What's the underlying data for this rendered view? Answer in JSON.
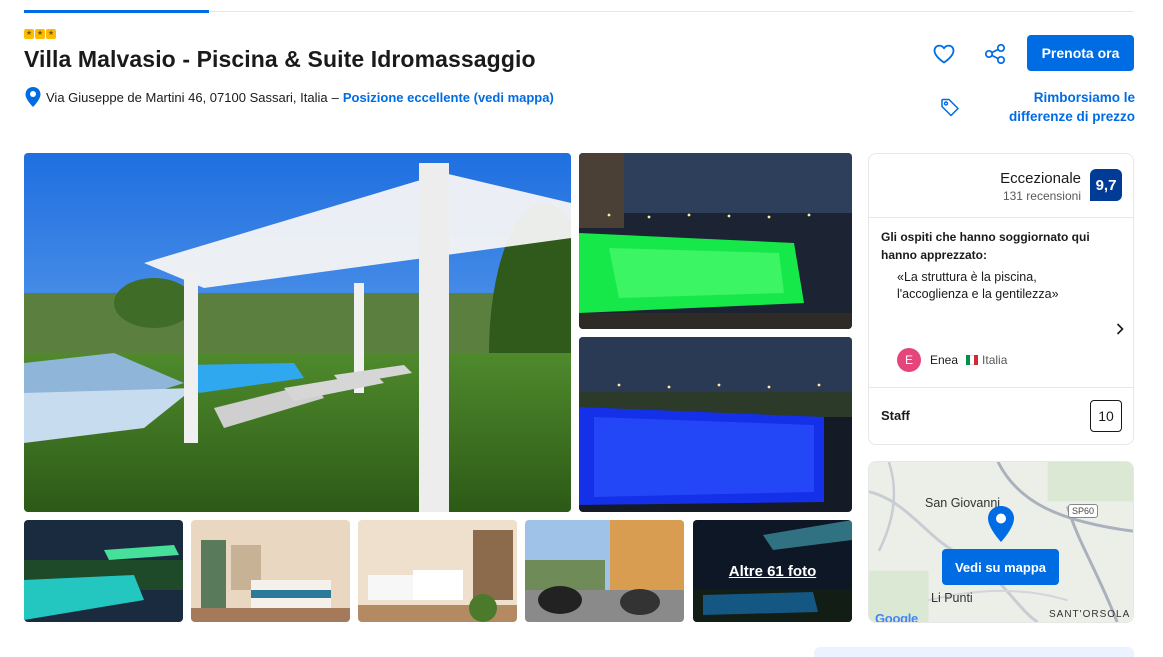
{
  "hotel": {
    "name": "Villa Malvasio - Piscina & Suite Idromassaggio",
    "stars": 3,
    "address": "Via Giuseppe de Martini 46, 07100 Sassari, Italia",
    "address_separator": "–",
    "location_link": "Posizione eccellente (vedi mappa)"
  },
  "header": {
    "book_button": "Prenota ora",
    "price_match": "Rimborsiamo le differenze di prezzo"
  },
  "gallery": {
    "more_photos": "Altre 61 foto"
  },
  "review": {
    "rating_word": "Eccezionale",
    "review_count": "131 recensioni",
    "score": "9,7",
    "guests_liked": "Gli ospiti che hanno soggiornato qui hanno apprezzato:",
    "quote": "«La struttura è la piscina, l'accoglienza e la gentilezza»",
    "reviewer_initial": "E",
    "reviewer_name": "Enea",
    "reviewer_country": "Italia",
    "staff_label": "Staff",
    "staff_score": "10"
  },
  "map": {
    "place_top": "San Giovanni",
    "road_badge": "SP60",
    "place_bottom": "Li Punti",
    "place_corner": "SANT'ORSOLA",
    "button": "Vedi su mappa",
    "attribution": "Google"
  },
  "colors": {
    "primary": "#006ce4",
    "score_badge": "#003b95",
    "star": "#febb02"
  }
}
